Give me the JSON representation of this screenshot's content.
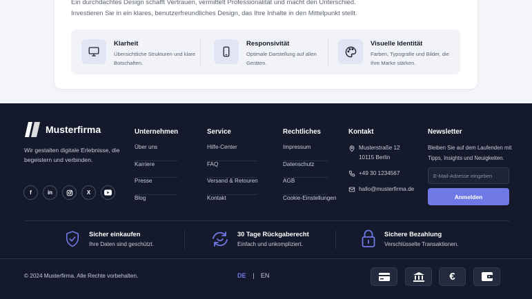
{
  "intro": {
    "line1": "Ein durchdachtes Design schafft Vertrauen, vermittelt Professionalität und macht den Unterschied.",
    "line2": "Investieren Sie in ein klares, benutzerfreundliches Design, das Ihre Inhalte in den Mittelpunkt stellt."
  },
  "features": [
    {
      "icon": "monitor-icon",
      "title": "Klarheit",
      "desc": "Übersichtliche Strukturen und klare Botschaften."
    },
    {
      "icon": "smartphone-icon",
      "title": "Responsivität",
      "desc": "Optimale Darstellung auf allen Geräten."
    },
    {
      "icon": "palette-icon",
      "title": "Visuelle Identität",
      "desc": "Farben, Typografie und Bilder, die Ihre Marke stärken."
    }
  ],
  "footer": {
    "brand": {
      "name": "Musterfirma",
      "tagline": "Wir gestalten digitale Erlebnisse, die begeistern und verbinden."
    },
    "socials": [
      {
        "icon": "facebook-icon",
        "glyph": "f"
      },
      {
        "icon": "linkedin-icon",
        "glyph": "in"
      },
      {
        "icon": "instagram-icon",
        "glyph": ""
      },
      {
        "icon": "x-icon",
        "glyph": "X"
      },
      {
        "icon": "youtube-icon",
        "glyph": ""
      }
    ],
    "columns": [
      {
        "title": "Unternehmen",
        "items": [
          "Über uns",
          "Karriere",
          "Presse",
          "Blog"
        ]
      },
      {
        "title": "Service",
        "items": [
          "Hilfe-Center",
          "FAQ",
          "Versand & Retouren",
          "Kontakt"
        ]
      },
      {
        "title": "Rechtliches",
        "items": [
          "Impressum",
          "Datenschutz",
          "AGB",
          "Cookie-Einstellungen"
        ]
      }
    ],
    "contact": {
      "title": "Kontakt",
      "address_line1": "Musterstraße 12",
      "address_line2": "10115 Berlin",
      "phone": "+49 30 1234567",
      "email": "hallo@musterfirma.de"
    },
    "newsletter": {
      "title": "Newsletter",
      "text": "Bleiben Sie auf dem Laufenden mit Tipps, Insights und Neuigkeiten.",
      "placeholder": "E-Mail-Adresse eingeben",
      "button": "Anmelden"
    },
    "trust": [
      {
        "icon": "shield-check-icon",
        "title": "Sicher einkaufen",
        "desc": "Ihre Daten sind geschützt."
      },
      {
        "icon": "return-arrows-icon",
        "title": "30 Tage Rückgaberecht",
        "desc": "Einfach und unkompliziert."
      },
      {
        "icon": "lock-icon",
        "title": "Sichere Bezahlung",
        "desc": "Verschlüsselte Transaktionen."
      }
    ],
    "copyright": "© 2024 Musterfirma. Alle Rechte vorbehalten.",
    "languages": {
      "active": "DE",
      "separator": "|",
      "other": "EN"
    },
    "payments": [
      "credit-card-icon",
      "bank-icon",
      "euro-icon",
      "wallet-icon"
    ],
    "colors": {
      "background": "#141a2c",
      "accent": "#6f79e6"
    }
  }
}
